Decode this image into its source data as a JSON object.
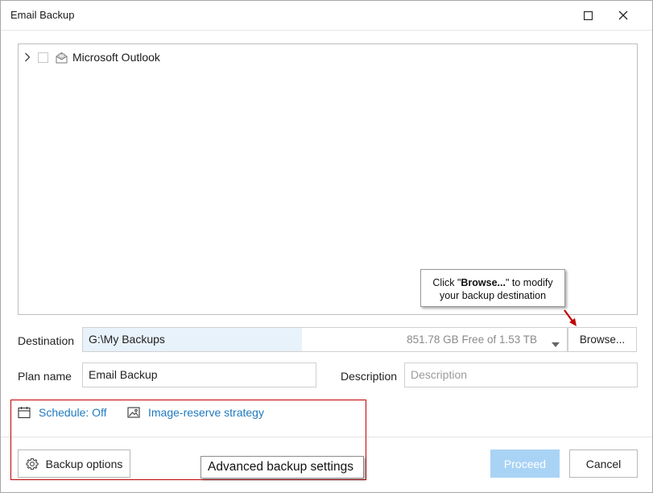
{
  "window": {
    "title": "Email Backup"
  },
  "tree": {
    "items": [
      {
        "label": "Microsoft Outlook",
        "expanded": false,
        "checked": false,
        "icon": "outlook-icon"
      }
    ]
  },
  "callout": {
    "prefix": "Click \"",
    "bold": "Browse...",
    "suffix": "\" to modify",
    "line2": "your backup destination"
  },
  "destination": {
    "label": "Destination",
    "path": "G:\\My Backups",
    "free_space": "851.78 GB Free of 1.53 TB",
    "browse_label": "Browse..."
  },
  "plan": {
    "label": "Plan name",
    "value": "Email Backup",
    "description_label": "Description",
    "description_placeholder": "Description"
  },
  "advanced": {
    "schedule_label": "Schedule: Off",
    "strategy_label": "Image-reserve strategy",
    "annotation": "Advanced backup settings"
  },
  "footer": {
    "options_label": "Backup options",
    "proceed_label": "Proceed",
    "cancel_label": "Cancel"
  },
  "colors": {
    "accent": "#1f7ac0",
    "proceed_disabled": "#a9d3f5",
    "highlight_box": "#c00000",
    "path_bg": "#e8f2fb"
  }
}
